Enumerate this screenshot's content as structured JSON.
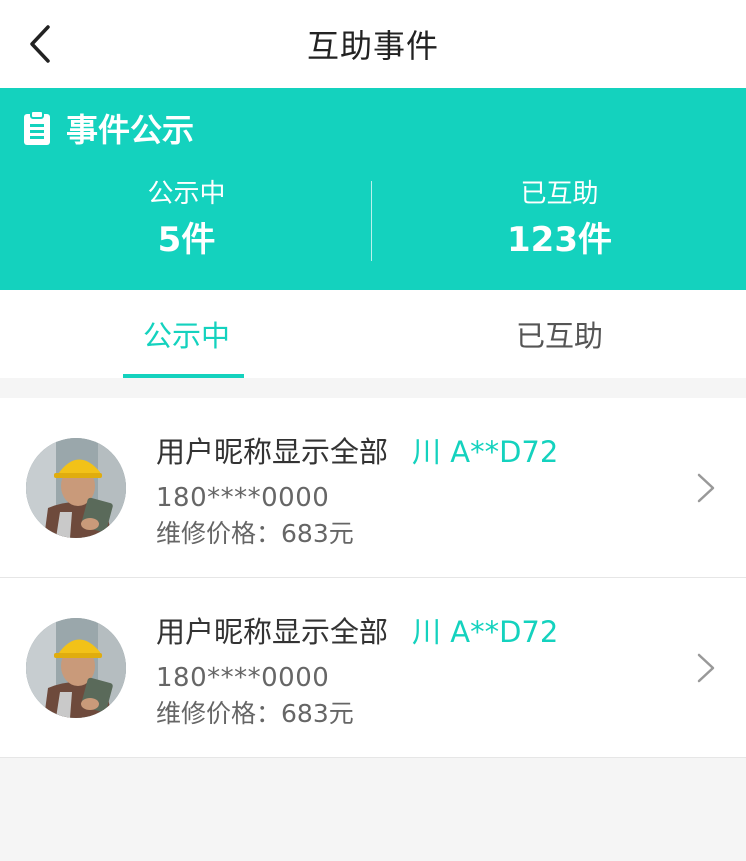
{
  "nav": {
    "title": "互助事件",
    "back_icon": "chevron-left-icon"
  },
  "banner": {
    "title": "事件公示",
    "icon": "clipboard-icon",
    "color": "#14d2be",
    "stats": [
      {
        "label": "公示中",
        "value": "5件"
      },
      {
        "label": "已互助",
        "value": "123件"
      }
    ]
  },
  "tabs": [
    {
      "label": "公示中",
      "active": true
    },
    {
      "label": "已互助",
      "active": false
    }
  ],
  "events": [
    {
      "name": "用户昵称显示全部",
      "plate": "川 A**D72",
      "phone": "180****0000",
      "price_label": "维修价格：",
      "price": "683元"
    },
    {
      "name": "用户昵称显示全部",
      "plate": "川 A**D72",
      "phone": "180****0000",
      "price_label": "维修价格：",
      "price": "683元"
    }
  ]
}
